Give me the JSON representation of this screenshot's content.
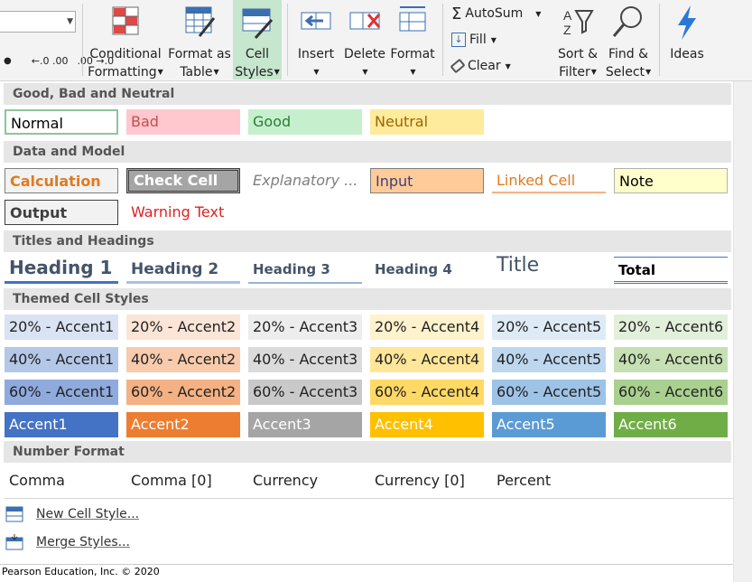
{
  "ribbon": {
    "conditional_formatting": [
      "Conditional",
      "Formatting"
    ],
    "format_as_table": [
      "Format as",
      "Table"
    ],
    "cell_styles": [
      "Cell",
      "Styles"
    ],
    "insert": "Insert",
    "delete": "Delete",
    "format": "Format",
    "autosum": "AutoSum",
    "fill": "Fill",
    "clear": "Clear",
    "sort_filter": [
      "Sort &",
      "Filter"
    ],
    "find_select": [
      "Find &",
      "Select"
    ],
    "ideas": "Ideas",
    "increase_decimal": "←.0 .00",
    "decrease_decimal": ".00 →.0"
  },
  "sections": {
    "good_bad_neutral": "Good, Bad and Neutral",
    "data_model": "Data and Model",
    "titles_headings": "Titles and Headings",
    "themed": "Themed Cell Styles",
    "number_format": "Number Format"
  },
  "styles": {
    "normal": "Normal",
    "bad": "Bad",
    "good": "Good",
    "neutral": "Neutral",
    "calculation": "Calculation",
    "check_cell": "Check Cell",
    "explanatory": "Explanatory ...",
    "input": "Input",
    "linked_cell": "Linked Cell",
    "note": "Note",
    "output": "Output",
    "warning_text": "Warning Text",
    "heading1": "Heading 1",
    "heading2": "Heading 2",
    "heading3": "Heading 3",
    "heading4": "Heading 4",
    "title": "Title",
    "total": "Total"
  },
  "themed_rows": [
    [
      "20% - Accent1",
      "20% - Accent2",
      "20% - Accent3",
      "20% - Accent4",
      "20% - Accent5",
      "20% - Accent6"
    ],
    [
      "40% - Accent1",
      "40% - Accent2",
      "40% - Accent3",
      "40% - Accent4",
      "40% - Accent5",
      "40% - Accent6"
    ],
    [
      "60% - Accent1",
      "60% - Accent2",
      "60% - Accent3",
      "60% - Accent4",
      "60% - Accent5",
      "60% - Accent6"
    ],
    [
      "Accent1",
      "Accent2",
      "Accent3",
      "Accent4",
      "Accent5",
      "Accent6"
    ]
  ],
  "number_formats": [
    "Comma",
    "Comma [0]",
    "Currency",
    "Currency [0]",
    "Percent"
  ],
  "menu": {
    "new_cell_style": "New Cell Style...",
    "merge_styles": "Merge Styles..."
  },
  "footer": "Pearson Education, Inc. © 2020",
  "colors": {
    "accent1": "#4472c4",
    "accent2": "#ed7d31",
    "accent3": "#a5a5a5",
    "accent4": "#ffc000",
    "accent5": "#5b9bd5",
    "accent6": "#70ad47",
    "selected_ribbon_button": "#c6e6cd"
  }
}
